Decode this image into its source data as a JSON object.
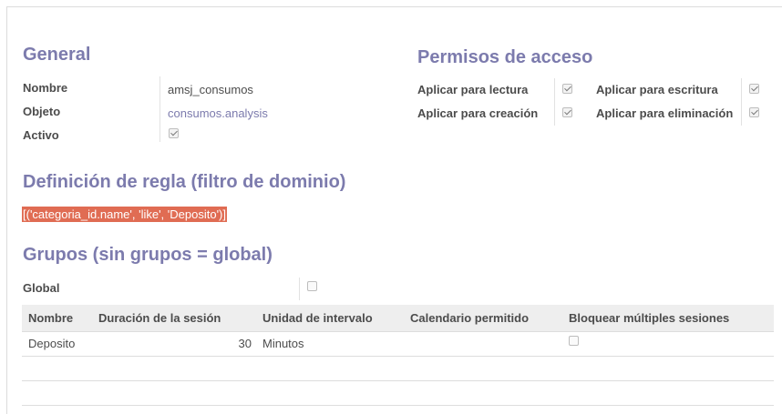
{
  "general": {
    "title": "General",
    "fields": [
      {
        "label": "Nombre",
        "value": "amsj_consumos"
      },
      {
        "label": "Objeto",
        "value": "consumos.analysis"
      },
      {
        "label": "Activo",
        "checked": true
      }
    ]
  },
  "permisos": {
    "title": "Permisos de acceso",
    "items": [
      {
        "label": "Aplicar para lectura",
        "checked": true
      },
      {
        "label": "Aplicar para escritura",
        "checked": true
      },
      {
        "label": "Aplicar para creación",
        "checked": true
      },
      {
        "label": "Aplicar para eliminación",
        "checked": true
      }
    ]
  },
  "regla": {
    "title": "Definición de regla (filtro de dominio)",
    "domain": "[('categoria_id.name', 'like', 'Deposito')]"
  },
  "grupos": {
    "title": "Grupos (sin grupos = global)",
    "global_label": "Global",
    "global_checked": false
  },
  "table": {
    "columns": [
      "Nombre",
      "Duración de la sesión",
      "Unidad de intervalo",
      "Calendario permitido",
      "Bloquear múltiples sesiones"
    ],
    "rows": [
      {
        "nombre": "Deposito",
        "duracion": "30",
        "unidad": "Minutos",
        "calendario": "",
        "bloquear": false
      }
    ]
  }
}
